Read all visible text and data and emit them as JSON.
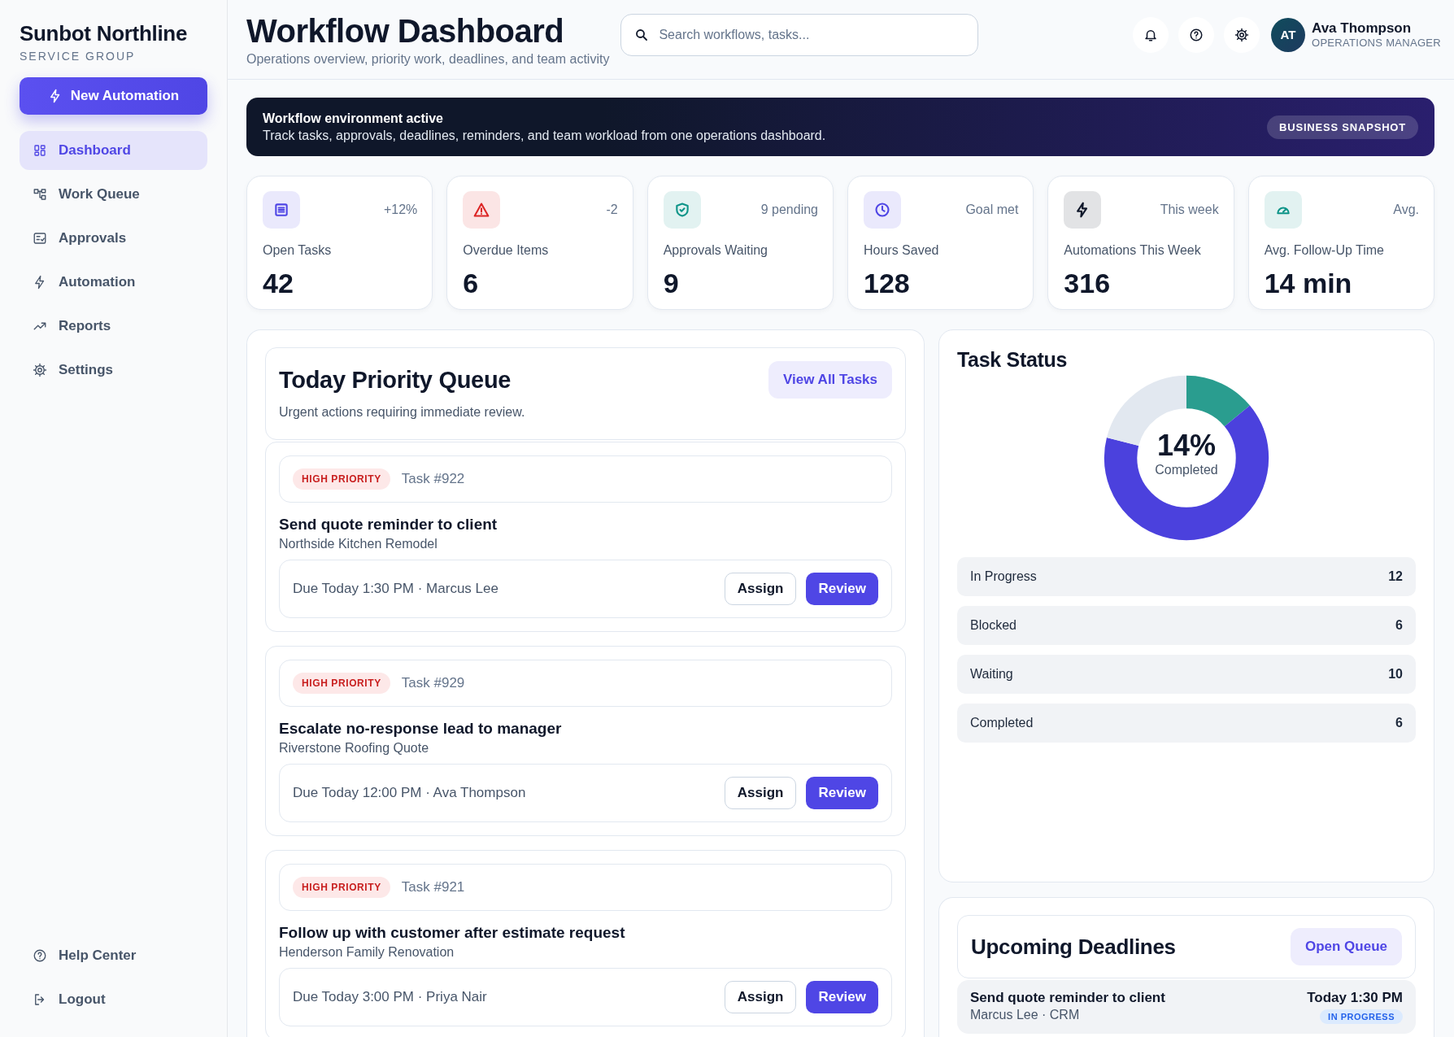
{
  "sidebar": {
    "brand": "Sunbot Northline",
    "subtitle": "SERVICE GROUP",
    "primary_button": "New Automation",
    "items": [
      {
        "label": "Dashboard",
        "selected": true
      },
      {
        "label": "Work Queue",
        "selected": false
      },
      {
        "label": "Approvals",
        "selected": false
      },
      {
        "label": "Automation",
        "selected": false
      },
      {
        "label": "Reports",
        "selected": false
      },
      {
        "label": "Settings",
        "selected": false
      }
    ],
    "footer_items": [
      "Help Center",
      "Logout"
    ]
  },
  "header": {
    "title": "Workflow Dashboard",
    "subtitle": "Operations overview, priority work, deadlines, and team activity",
    "search": {
      "placeholder": "Search workflows, tasks..."
    },
    "user": {
      "initials": "AT",
      "name": "Ava Thompson",
      "role": "OPERATIONS MANAGER"
    }
  },
  "banner": {
    "title": "Workflow environment active",
    "text": "Track tasks, approvals, deadlines, reminders, and team workload from one operations dashboard.",
    "badge": "BUSINESS SNAPSHOT"
  },
  "stats": [
    {
      "label": "Open Tasks",
      "value": "42",
      "note": "+12%",
      "color": "#4f46e5"
    },
    {
      "label": "Overdue Items",
      "value": "6",
      "note": "-2",
      "color": "#dc2626"
    },
    {
      "label": "Approvals Waiting",
      "value": "9",
      "note": "9 pending",
      "color": "#0d9488"
    },
    {
      "label": "Hours Saved",
      "value": "128",
      "note": "Goal met",
      "color": "#4f46e5"
    },
    {
      "label": "Automations This Week",
      "value": "316",
      "note": "This week",
      "color": "#0f172a"
    },
    {
      "label": "Avg. Follow-Up Time",
      "value": "14 min",
      "note": "Avg.",
      "color": "#0d9488"
    }
  ],
  "priority_queue": {
    "title": "Today Priority Queue",
    "subtitle": "Urgent actions requiring immediate review.",
    "button": "View All Tasks",
    "tasks": [
      {
        "priority": "HIGH PRIORITY",
        "task_id": "Task #922",
        "title": "Send quote reminder to client",
        "client": "Northside Kitchen Remodel",
        "due": "Due Today 1:30 PM · Marcus Lee",
        "buttons": [
          "Assign",
          "Review"
        ]
      },
      {
        "priority": "HIGH PRIORITY",
        "task_id": "Task #929",
        "title": "Escalate no-response lead to manager",
        "client": "Riverstone Roofing Quote",
        "due": "Due Today 12:00 PM · Ava Thompson",
        "buttons": [
          "Assign",
          "Review"
        ]
      },
      {
        "priority": "HIGH PRIORITY",
        "task_id": "Task #921",
        "title": "Follow up with customer after estimate request",
        "client": "Henderson Family Renovation",
        "due": "Due Today 3:00 PM · Priya Nair",
        "buttons": [
          "Assign",
          "Review"
        ]
      }
    ]
  },
  "task_status": {
    "title": "Task Status",
    "center_value": "14%",
    "center_label": "Completed",
    "rows": [
      {
        "label": "In Progress",
        "count": "12"
      },
      {
        "label": "Blocked",
        "count": "6"
      },
      {
        "label": "Waiting",
        "count": "10"
      },
      {
        "label": "Completed",
        "count": "6"
      }
    ]
  },
  "deadlines": {
    "title": "Upcoming Deadlines",
    "button": "Open Queue",
    "items": [
      {
        "title": "Send quote reminder to client",
        "meta": "Marcus Lee · CRM",
        "time": "Today 1:30 PM",
        "status": "IN PROGRESS"
      }
    ]
  }
}
